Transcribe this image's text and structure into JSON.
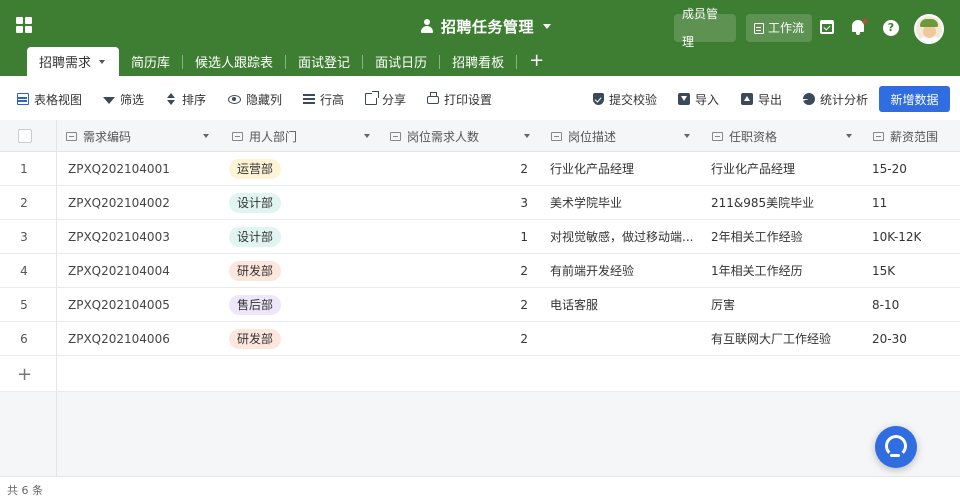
{
  "app": {
    "title": "招聘任务管理",
    "members_label": "成员管理",
    "workflow_label": "工作流",
    "help_label": "?"
  },
  "tabs": [
    {
      "label": "招聘需求",
      "active": true
    },
    {
      "label": "简历库"
    },
    {
      "label": "候选人跟踪表"
    },
    {
      "label": "面试登记"
    },
    {
      "label": "面试日历"
    },
    {
      "label": "招聘看板"
    }
  ],
  "tab_add": "+",
  "toolbar": {
    "table_view": "表格视图",
    "filter": "筛选",
    "sort": "排序",
    "hide_cols": "隐藏列",
    "row_height": "行高",
    "share": "分享",
    "print_settings": "打印设置",
    "submit_check": "提交校验",
    "import": "导入",
    "export": "导出",
    "stats": "统计分析",
    "new_data": "新增数据"
  },
  "columns": [
    "需求编码",
    "用人部门",
    "岗位需求人数",
    "岗位描述",
    "任职资格",
    "薪资范围"
  ],
  "rows": [
    {
      "idx": "1",
      "code": "ZPXQ202104001",
      "dept": "运营部",
      "dept_color": "#fdf3d5",
      "num": "2",
      "desc": "行业化产品经理",
      "qual": "行业化产品经理",
      "salary": "15-20"
    },
    {
      "idx": "2",
      "code": "ZPXQ202104002",
      "dept": "设计部",
      "dept_color": "#e0f5f1",
      "num": "3",
      "desc": "美术学院毕业",
      "qual": "211&985美院毕业",
      "salary": "11"
    },
    {
      "idx": "3",
      "code": "ZPXQ202104003",
      "dept": "设计部",
      "dept_color": "#e0f5f1",
      "num": "1",
      "desc": "对视觉敏感，做过移动端...",
      "qual": "2年相关工作经验",
      "salary": "10K-12K"
    },
    {
      "idx": "4",
      "code": "ZPXQ202104004",
      "dept": "研发部",
      "dept_color": "#fde7dd",
      "num": "2",
      "desc": "有前端开发经验",
      "qual": "1年相关工作经历",
      "salary": "15K"
    },
    {
      "idx": "5",
      "code": "ZPXQ202104005",
      "dept": "售后部",
      "dept_color": "#eee6fa",
      "num": "2",
      "desc": "电话客服",
      "qual": "厉害",
      "salary": "8-10"
    },
    {
      "idx": "6",
      "code": "ZPXQ202104006",
      "dept": "研发部",
      "dept_color": "#fde7dd",
      "num": "2",
      "desc": "",
      "qual": "有互联网大厂工作经验",
      "salary": "20-30"
    }
  ],
  "add_row": "+",
  "footer": {
    "count_text": "共 6 条"
  },
  "colors": {
    "header": "#3e7e33",
    "primary": "#2f6de1"
  }
}
